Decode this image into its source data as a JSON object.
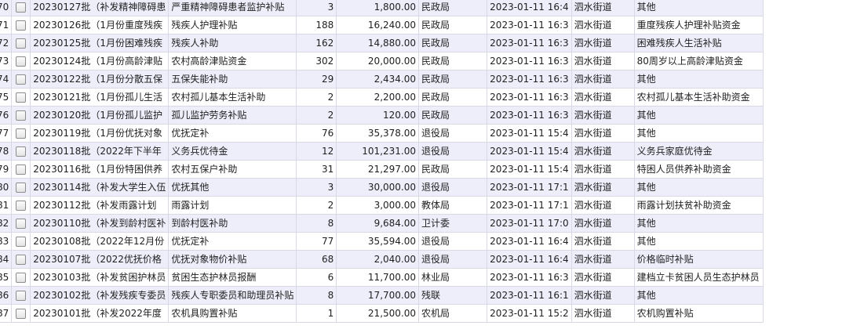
{
  "rows": [
    {
      "idx": "70",
      "batch": "20230127批（补发精神障碍患",
      "item": "严重精神障碍患者监护补贴",
      "count": "3",
      "amount": "1,800.00",
      "dept": "民政局",
      "date": "2023-01-11 16:4",
      "street": "泗水街道",
      "remark": "其他"
    },
    {
      "idx": "71",
      "batch": "20230126批（1月份重度残疾",
      "item": "残疾人护理补贴",
      "count": "188",
      "amount": "16,240.00",
      "dept": "民政局",
      "date": "2023-01-11 16:3",
      "street": "泗水街道",
      "remark": "重度残疾人护理补贴资金"
    },
    {
      "idx": "72",
      "batch": "20230125批（1月份困难残疾",
      "item": "残疾人补助",
      "count": "162",
      "amount": "14,880.00",
      "dept": "民政局",
      "date": "2023-01-11 16:3",
      "street": "泗水街道",
      "remark": "困难残疾人生活补贴"
    },
    {
      "idx": "73",
      "batch": "20230124批（1月份高龄津贴",
      "item": "农村高龄津贴资金",
      "count": "302",
      "amount": "20,000.00",
      "dept": "民政局",
      "date": "2023-01-11 16:3",
      "street": "泗水街道",
      "remark": "80周岁以上高龄津贴资金"
    },
    {
      "idx": "74",
      "batch": "20230122批（1月份分散五保",
      "item": "五保失能补助",
      "count": "29",
      "amount": "2,434.00",
      "dept": "民政局",
      "date": "2023-01-11 16:3",
      "street": "泗水街道",
      "remark": "其他"
    },
    {
      "idx": "75",
      "batch": "20230121批（1月份孤儿生活",
      "item": "农村孤儿基本生活补助",
      "count": "2",
      "amount": "2,200.00",
      "dept": "民政局",
      "date": "2023-01-11 16:3",
      "street": "泗水街道",
      "remark": "农村孤儿基本生活补助资金"
    },
    {
      "idx": "76",
      "batch": "20230120批（1月份孤儿监护",
      "item": "孤儿监护劳务补贴",
      "count": "2",
      "amount": "120.00",
      "dept": "民政局",
      "date": "2023-01-11 16:3",
      "street": "泗水街道",
      "remark": "其他"
    },
    {
      "idx": "77",
      "batch": "20230119批（1月份优抚对象",
      "item": "优抚定补",
      "count": "76",
      "amount": "35,378.00",
      "dept": "退役局",
      "date": "2023-01-11 15:4",
      "street": "泗水街道",
      "remark": "其他"
    },
    {
      "idx": "78",
      "batch": "20230118批（2022年下半年",
      "item": "义务兵优待金",
      "count": "12",
      "amount": "101,231.00",
      "dept": "退役局",
      "date": "2023-01-11 15:4",
      "street": "泗水街道",
      "remark": "义务兵家庭优待金"
    },
    {
      "idx": "79",
      "batch": "20230116批（1月份特困供养",
      "item": "农村五保户补助",
      "count": "31",
      "amount": "21,297.00",
      "dept": "民政局",
      "date": "2023-01-11 15:4",
      "street": "泗水街道",
      "remark": "特困人员供养补助资金"
    },
    {
      "idx": "80",
      "batch": "20230114批（补发大学生入伍",
      "item": "优抚其他",
      "count": "3",
      "amount": "30,000.00",
      "dept": "退役局",
      "date": "2023-01-11 17:1",
      "street": "泗水街道",
      "remark": "其他"
    },
    {
      "idx": "81",
      "batch": "20230112批（补发雨露计划",
      "item": "雨露计划",
      "count": "2",
      "amount": "3,000.00",
      "dept": "教体局",
      "date": "2023-01-11 17:1",
      "street": "泗水街道",
      "remark": "雨露计划扶贫补助资金"
    },
    {
      "idx": "82",
      "batch": "20230110批（补发到龄村医补",
      "item": "到龄村医补助",
      "count": "8",
      "amount": "9,684.00",
      "dept": "卫计委",
      "date": "2023-01-11 17:0",
      "street": "泗水街道",
      "remark": "其他"
    },
    {
      "idx": "83",
      "batch": "20230108批（2022年12月份",
      "item": "优抚定补",
      "count": "77",
      "amount": "35,594.00",
      "dept": "退役局",
      "date": "2023-01-11 16:4",
      "street": "泗水街道",
      "remark": "其他"
    },
    {
      "idx": "84",
      "batch": "20230107批（2022优抚价格",
      "item": "优抚对象物价补贴",
      "count": "68",
      "amount": "2,040.00",
      "dept": "退役局",
      "date": "2023-01-11 16:4",
      "street": "泗水街道",
      "remark": "价格临时补贴"
    },
    {
      "idx": "85",
      "batch": "20230103批（补发贫困护林员",
      "item": "贫困生态护林员报酬",
      "count": "6",
      "amount": "11,700.00",
      "dept": "林业局",
      "date": "2023-01-11 16:3",
      "street": "泗水街道",
      "remark": "建档立卡贫困人员生态护林员"
    },
    {
      "idx": "86",
      "batch": "20230102批（补发残疾专委员",
      "item": "残疾人专职委员和助理员补贴",
      "count": "8",
      "amount": "17,700.00",
      "dept": "残联",
      "date": "2023-01-11 16:1",
      "street": "泗水街道",
      "remark": "其他"
    },
    {
      "idx": "87",
      "batch": "20230101批（补发2022年度",
      "item": "农机具购置补贴",
      "count": "1",
      "amount": "21,500.00",
      "dept": "农机局",
      "date": "2023-01-11 15:2",
      "street": "泗水街道",
      "remark": "农机购置补贴"
    }
  ]
}
